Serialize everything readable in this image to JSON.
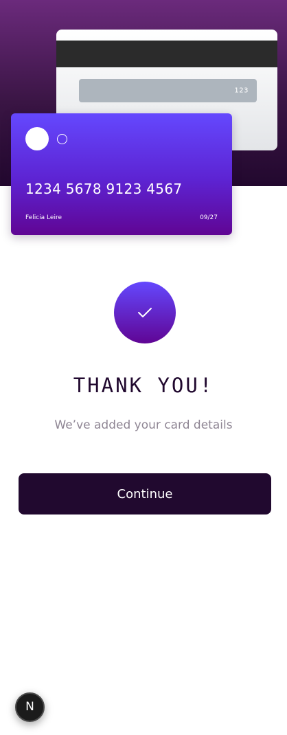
{
  "card_back": {
    "cvc": "123"
  },
  "card_front": {
    "number": "1234 5678 9123 4567",
    "holder_name": "Felicia Leire",
    "expiry": "09/27"
  },
  "confirmation": {
    "icon": "check-icon",
    "heading": "THANK YOU!",
    "message": "We’ve added your card details"
  },
  "actions": {
    "continue_label": "Continue"
  },
  "dev_badge": {
    "letter": "N"
  },
  "colors": {
    "hero_top": "#6b2a7c",
    "hero_bottom": "#22082e",
    "card_front_top": "#6448fe",
    "card_front_bottom": "#600594",
    "primary_dark": "#21092f",
    "muted_text": "#8f8694",
    "cvc_bar": "#adb5bd",
    "mag_stripe": "#2b2b2b"
  }
}
